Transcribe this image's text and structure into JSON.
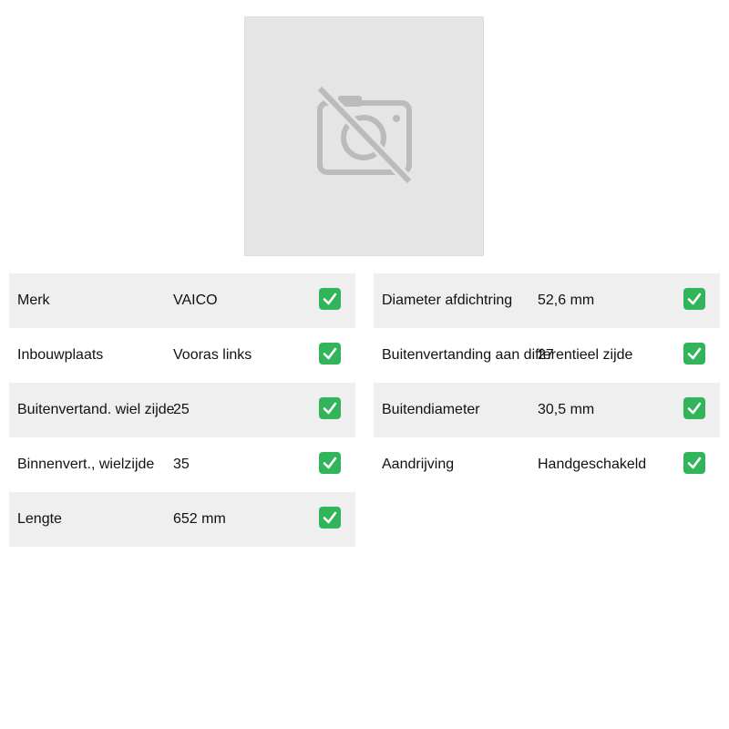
{
  "image": {
    "icon": "no-camera-icon"
  },
  "left_specs": [
    {
      "label": "Merk",
      "value": "VAICO",
      "status_icon": "check-icon"
    },
    {
      "label": "Inbouwplaats",
      "value": "Vooras links",
      "status_icon": "check-icon"
    },
    {
      "label": "Buitenvertand. wiel zijde",
      "value": "25",
      "status_icon": "check-icon"
    },
    {
      "label": "Binnenvert., wielzijde",
      "value": "35",
      "status_icon": "check-icon"
    },
    {
      "label": "Lengte",
      "value": "652 mm",
      "status_icon": "check-icon"
    }
  ],
  "right_specs": [
    {
      "label": "Diameter afdichtring",
      "value": "52,6 mm",
      "status_icon": "check-icon"
    },
    {
      "label": "Buitenvertanding aan differentieel zijde",
      "value": "27",
      "status_icon": "check-icon"
    },
    {
      "label": "Buitendiameter",
      "value": "30,5 mm",
      "status_icon": "check-icon"
    },
    {
      "label": "Aandrijving",
      "value": "Handgeschakeld",
      "status_icon": "check-icon"
    }
  ],
  "colors": {
    "check": "#32b45a",
    "row_shade": "#efefef",
    "placeholder_bg": "#e5e5e5"
  }
}
